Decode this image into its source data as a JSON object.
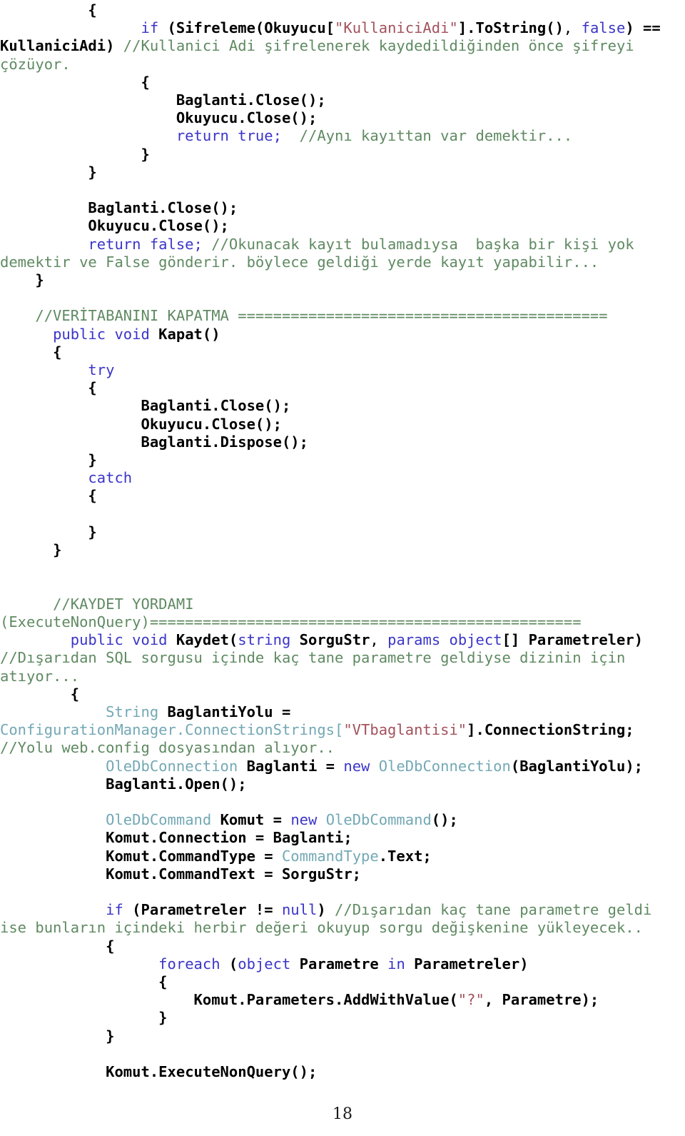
{
  "document": {
    "page_number": "18",
    "language": "csharp",
    "colors": {
      "background": "#ffffff",
      "text": "#000000",
      "keyword": "#3b35c8",
      "comment": "#5f8a62",
      "string": "#a3525c",
      "type": "#73a8b4",
      "identifier": "#000000"
    }
  },
  "code": {
    "lines": [
      {
        "id": "line-1",
        "indent": 5,
        "tokens": [
          {
            "t": "{",
            "c": "bk"
          }
        ]
      },
      {
        "id": "line-2",
        "indent": 8,
        "tokens": [
          {
            "t": "if",
            "c": "kw"
          },
          {
            "t": " ",
            "c": "pl"
          },
          {
            "t": "(Sifreleme(Okuyucu[",
            "c": "bk"
          },
          {
            "t": "\"KullaniciAdi\"",
            "c": "st"
          },
          {
            "t": "].ToString()",
            "c": "bk"
          },
          {
            "t": ", ",
            "c": "pl"
          },
          {
            "t": "false",
            "c": "kw"
          },
          {
            "t": ") ==",
            "c": "bk"
          },
          {
            "t": " ",
            "c": "pl"
          },
          {
            "t": "KullaniciAdi)",
            "c": "bk"
          },
          {
            "t": " ",
            "c": "pl"
          },
          {
            "t": "//Kullanici Adi şifrelenerek kaydedildiğinden önce şifreyi çözüyor.",
            "c": "cm"
          }
        ]
      },
      {
        "id": "line-3",
        "indent": 8,
        "tokens": [
          {
            "t": "{",
            "c": "bk"
          }
        ]
      },
      {
        "id": "line-4",
        "indent": 10,
        "tokens": [
          {
            "t": "Baglanti.Close();",
            "c": "id"
          }
        ]
      },
      {
        "id": "line-5",
        "indent": 10,
        "tokens": [
          {
            "t": "Okuyucu.Close();",
            "c": "id"
          }
        ]
      },
      {
        "id": "line-6",
        "indent": 10,
        "tokens": [
          {
            "t": "return true;",
            "c": "kw"
          },
          {
            "t": "  ",
            "c": "pl"
          },
          {
            "t": "//Aynı kayıttan var demektir...",
            "c": "cm"
          }
        ]
      },
      {
        "id": "line-7",
        "indent": 8,
        "tokens": [
          {
            "t": "}",
            "c": "bk"
          }
        ]
      },
      {
        "id": "line-8",
        "indent": 5,
        "tokens": [
          {
            "t": "}",
            "c": "bk"
          }
        ]
      },
      {
        "id": "line-9",
        "indent": 0,
        "tokens": []
      },
      {
        "id": "line-10",
        "indent": 5,
        "tokens": [
          {
            "t": "Baglanti.Close();",
            "c": "id"
          }
        ]
      },
      {
        "id": "line-11",
        "indent": 5,
        "tokens": [
          {
            "t": "Okuyucu.Close();",
            "c": "id"
          }
        ]
      },
      {
        "id": "line-12",
        "indent": 5,
        "tokens": [
          {
            "t": "return false;",
            "c": "kw"
          },
          {
            "t": " ",
            "c": "pl"
          },
          {
            "t": "//Okunacak kayıt bulamadıysa  başka bir kişi yok demektir ve False gönderir. böylece geldiği yerde kayıt yapabilir...",
            "c": "cm"
          }
        ]
      },
      {
        "id": "line-13",
        "indent": 2,
        "tokens": [
          {
            "t": "}",
            "c": "bk"
          }
        ]
      },
      {
        "id": "line-14",
        "indent": 0,
        "tokens": []
      },
      {
        "id": "line-15",
        "indent": 2,
        "tokens": [
          {
            "t": "//VERİTABANINI KAPATMA ==========================================",
            "c": "cm"
          }
        ]
      },
      {
        "id": "line-16",
        "indent": 3,
        "tokens": [
          {
            "t": "public void",
            "c": "kw"
          },
          {
            "t": " ",
            "c": "pl"
          },
          {
            "t": "Kapat()",
            "c": "id"
          }
        ]
      },
      {
        "id": "line-17",
        "indent": 3,
        "tokens": [
          {
            "t": "{",
            "c": "bk"
          }
        ]
      },
      {
        "id": "line-18",
        "indent": 5,
        "tokens": [
          {
            "t": "try",
            "c": "kw"
          }
        ]
      },
      {
        "id": "line-19",
        "indent": 5,
        "tokens": [
          {
            "t": "{",
            "c": "bk"
          }
        ]
      },
      {
        "id": "line-20",
        "indent": 8,
        "tokens": [
          {
            "t": "Baglanti.Close();",
            "c": "id"
          }
        ]
      },
      {
        "id": "line-21",
        "indent": 8,
        "tokens": [
          {
            "t": "Okuyucu.Close();",
            "c": "id"
          }
        ]
      },
      {
        "id": "line-22",
        "indent": 8,
        "tokens": [
          {
            "t": "Baglanti.Dispose();",
            "c": "id"
          }
        ]
      },
      {
        "id": "line-23",
        "indent": 5,
        "tokens": [
          {
            "t": "}",
            "c": "bk"
          }
        ]
      },
      {
        "id": "line-24",
        "indent": 5,
        "tokens": [
          {
            "t": "catch",
            "c": "kw"
          }
        ]
      },
      {
        "id": "line-25",
        "indent": 5,
        "tokens": [
          {
            "t": "{",
            "c": "bk"
          }
        ]
      },
      {
        "id": "line-26",
        "indent": 0,
        "tokens": []
      },
      {
        "id": "line-27",
        "indent": 5,
        "tokens": [
          {
            "t": "}",
            "c": "bk"
          }
        ]
      },
      {
        "id": "line-28",
        "indent": 3,
        "tokens": [
          {
            "t": "}",
            "c": "bk"
          }
        ]
      },
      {
        "id": "line-29",
        "indent": 0,
        "tokens": []
      },
      {
        "id": "line-30",
        "indent": 0,
        "tokens": []
      },
      {
        "id": "line-31",
        "indent": 3,
        "tokens": [
          {
            "t": "//KAYDET YORDAMI (ExecuteNonQuery)=================================================",
            "c": "cm"
          }
        ]
      },
      {
        "id": "line-32",
        "indent": 4,
        "tokens": [
          {
            "t": "public void",
            "c": "kw"
          },
          {
            "t": " ",
            "c": "pl"
          },
          {
            "t": "Kaydet(",
            "c": "id"
          },
          {
            "t": "string",
            "c": "kw"
          },
          {
            "t": " ",
            "c": "pl"
          },
          {
            "t": "SorguStr",
            "c": "id"
          },
          {
            "t": ", ",
            "c": "pl"
          },
          {
            "t": "params object",
            "c": "kw"
          },
          {
            "t": "[] ",
            "c": "id"
          },
          {
            "t": "Parametreler)",
            "c": "id"
          },
          {
            "t": " ",
            "c": "pl"
          },
          {
            "t": "//Dışarıdan SQL sorgusu içinde kaç tane parametre geldiyse dizinin için atıyor...",
            "c": "cm"
          }
        ]
      },
      {
        "id": "line-33",
        "indent": 4,
        "tokens": [
          {
            "t": "{",
            "c": "bk"
          }
        ]
      },
      {
        "id": "line-34",
        "indent": 6,
        "tokens": [
          {
            "t": "String",
            "c": "ty"
          },
          {
            "t": " ",
            "c": "pl"
          },
          {
            "t": "BaglantiYolu =",
            "c": "id"
          },
          {
            "t": " ",
            "c": "pl"
          },
          {
            "t": "ConfigurationManager",
            "c": "ty"
          },
          {
            "t": ".ConnectionStrings[",
            "c": "ty"
          },
          {
            "t": "\"VTbaglantisi\"",
            "c": "st"
          },
          {
            "t": "].ConnectionString;",
            "c": "id"
          },
          {
            "t": " ",
            "c": "pl"
          },
          {
            "t": "//Yolu web.config dosyasından alıyor..",
            "c": "cm"
          }
        ]
      },
      {
        "id": "line-35",
        "indent": 6,
        "tokens": [
          {
            "t": "OleDbConnection",
            "c": "ty"
          },
          {
            "t": " ",
            "c": "pl"
          },
          {
            "t": "Baglanti =",
            "c": "id"
          },
          {
            "t": " ",
            "c": "pl"
          },
          {
            "t": "new",
            "c": "kw"
          },
          {
            "t": " ",
            "c": "pl"
          },
          {
            "t": "OleDbConnection",
            "c": "ty"
          },
          {
            "t": "(BaglantiYolu);",
            "c": "id"
          }
        ]
      },
      {
        "id": "line-36",
        "indent": 6,
        "tokens": [
          {
            "t": "Baglanti.Open();",
            "c": "id"
          }
        ]
      },
      {
        "id": "line-37",
        "indent": 0,
        "tokens": []
      },
      {
        "id": "line-38",
        "indent": 6,
        "tokens": [
          {
            "t": "OleDbCommand",
            "c": "ty"
          },
          {
            "t": " ",
            "c": "pl"
          },
          {
            "t": "Komut =",
            "c": "id"
          },
          {
            "t": " ",
            "c": "pl"
          },
          {
            "t": "new",
            "c": "kw"
          },
          {
            "t": " ",
            "c": "pl"
          },
          {
            "t": "OleDbCommand",
            "c": "ty"
          },
          {
            "t": "();",
            "c": "id"
          }
        ]
      },
      {
        "id": "line-39",
        "indent": 6,
        "tokens": [
          {
            "t": "Komut.Connection = Baglanti;",
            "c": "id"
          }
        ]
      },
      {
        "id": "line-40",
        "indent": 6,
        "tokens": [
          {
            "t": "Komut.CommandType = ",
            "c": "id"
          },
          {
            "t": "CommandType",
            "c": "ty"
          },
          {
            "t": ".Text;",
            "c": "id"
          }
        ]
      },
      {
        "id": "line-41",
        "indent": 6,
        "tokens": [
          {
            "t": "Komut.CommandText = SorguStr;",
            "c": "id"
          }
        ]
      },
      {
        "id": "line-42",
        "indent": 0,
        "tokens": []
      },
      {
        "id": "line-43",
        "indent": 6,
        "tokens": [
          {
            "t": "if",
            "c": "kw"
          },
          {
            "t": " ",
            "c": "pl"
          },
          {
            "t": "(Parametreler !=",
            "c": "id"
          },
          {
            "t": " ",
            "c": "pl"
          },
          {
            "t": "null",
            "c": "kw"
          },
          {
            "t": ")",
            "c": "id"
          },
          {
            "t": " ",
            "c": "pl"
          },
          {
            "t": "//Dışarıdan kaç tane parametre geldi ise bunların içindeki herbir değeri okuyup sorgu değişkenine yükleyecek..",
            "c": "cm"
          }
        ]
      },
      {
        "id": "line-44",
        "indent": 6,
        "tokens": [
          {
            "t": "{",
            "c": "bk"
          }
        ]
      },
      {
        "id": "line-45",
        "indent": 9,
        "tokens": [
          {
            "t": "foreach",
            "c": "kw"
          },
          {
            "t": " ",
            "c": "pl"
          },
          {
            "t": "(",
            "c": "bk"
          },
          {
            "t": "object",
            "c": "kw"
          },
          {
            "t": " ",
            "c": "pl"
          },
          {
            "t": "Parametre",
            "c": "id"
          },
          {
            "t": " ",
            "c": "pl"
          },
          {
            "t": "in",
            "c": "kw"
          },
          {
            "t": " ",
            "c": "pl"
          },
          {
            "t": "Parametreler)",
            "c": "id"
          }
        ]
      },
      {
        "id": "line-46",
        "indent": 9,
        "tokens": [
          {
            "t": "{",
            "c": "bk"
          }
        ]
      },
      {
        "id": "line-47",
        "indent": 11,
        "tokens": [
          {
            "t": "Komut.Parameters.AddWithValue(",
            "c": "id"
          },
          {
            "t": "\"?\"",
            "c": "st"
          },
          {
            "t": ", Parametre);",
            "c": "id"
          }
        ]
      },
      {
        "id": "line-48",
        "indent": 9,
        "tokens": [
          {
            "t": "}",
            "c": "bk"
          }
        ]
      },
      {
        "id": "line-49",
        "indent": 6,
        "tokens": [
          {
            "t": "}",
            "c": "bk"
          }
        ]
      },
      {
        "id": "line-50",
        "indent": 0,
        "tokens": []
      },
      {
        "id": "line-51",
        "indent": 6,
        "tokens": [
          {
            "t": "Komut.ExecuteNonQuery();",
            "c": "id"
          }
        ]
      }
    ]
  }
}
